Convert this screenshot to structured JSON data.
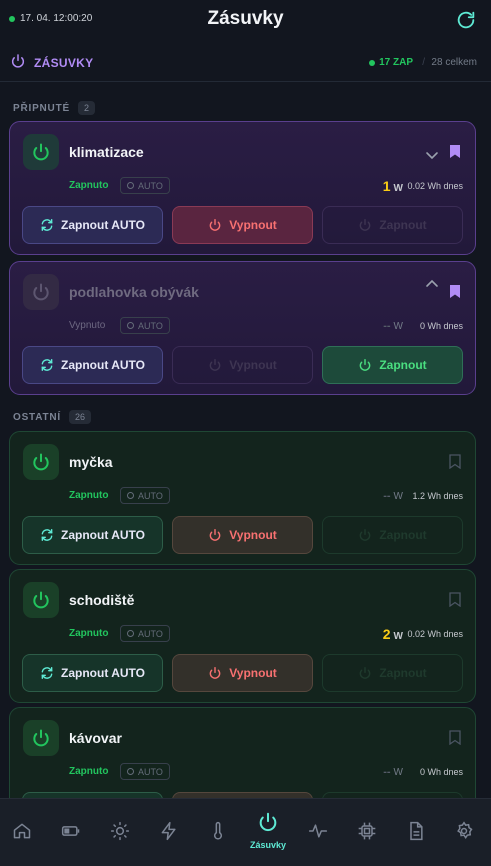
{
  "header": {
    "clock": "17. 04. 12:00:20",
    "title": "Zásuvky",
    "refresh_icon": "refresh-icon"
  },
  "subbar": {
    "label": "ZÁSUVKY",
    "on_count": "17 ZAP",
    "separator": "/",
    "total": "28 celkem"
  },
  "sections": {
    "pinned": {
      "label": "PŘIPNUTÉ",
      "count": "2"
    },
    "other": {
      "label": "OSTATNÍ",
      "count": "26"
    }
  },
  "labels": {
    "auto": "AUTO",
    "btn_auto": "Zapnout AUTO",
    "btn_off": "Vypnout",
    "btn_on": "Zapnout",
    "unit_w": "W"
  },
  "cards": [
    {
      "name": "klimatizace",
      "status": "Zapnuto",
      "power": "1",
      "energy": "0.02 Wh dnes",
      "pinned": true,
      "state": "on",
      "chevron": "down"
    },
    {
      "name": "podlahovka obývák",
      "status": "Vypnuto",
      "power": "--",
      "energy": "0 Wh dnes",
      "pinned": true,
      "state": "off",
      "chevron": "up"
    },
    {
      "name": "myčka",
      "status": "Zapnuto",
      "power": "--",
      "energy": "1.2 Wh dnes",
      "pinned": false,
      "state": "on"
    },
    {
      "name": "schodiště",
      "status": "Zapnuto",
      "power": "2",
      "energy": "0.02 Wh dnes",
      "pinned": false,
      "state": "on"
    },
    {
      "name": "kávovar",
      "status": "Zapnuto",
      "power": "--",
      "energy": "0 Wh dnes",
      "pinned": false,
      "state": "on"
    }
  ],
  "nav": {
    "items": [
      "home-icon",
      "battery-icon",
      "sun-icon",
      "bolt-icon",
      "thermometer-icon",
      "power-icon",
      "pulse-icon",
      "chip-icon",
      "document-icon",
      "settings-icon"
    ],
    "active_label": "Zásuvky"
  },
  "colors": {
    "accent_on": "#22c55e",
    "accent_purple": "#b18cf5",
    "power_yellow": "#facc15",
    "off_red": "#f87171",
    "nav_active": "#5eead4"
  }
}
